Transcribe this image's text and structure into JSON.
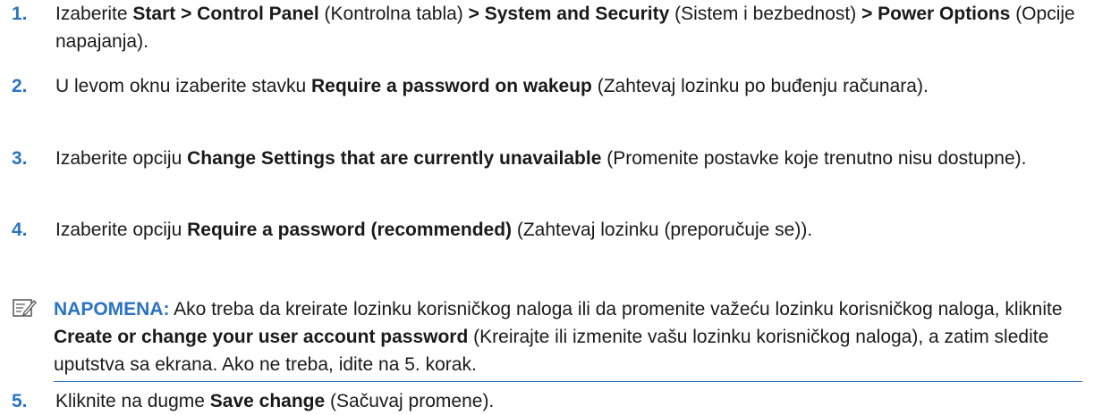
{
  "steps": [
    {
      "number": "1.",
      "text": [
        {
          "t": "Izaberite ",
          "b": false
        },
        {
          "t": "Start > Control Panel",
          "b": true
        },
        {
          "t": " (Kontrolna tabla) ",
          "b": false
        },
        {
          "t": "> System and Security",
          "b": true
        },
        {
          "t": " (Sistem i bezbednost) ",
          "b": false
        },
        {
          "t": "> Power Options",
          "b": true
        },
        {
          "t": " (Opcije napajanja).",
          "b": false
        }
      ]
    },
    {
      "number": "2.",
      "text": [
        {
          "t": "U levom oknu izaberite stavku ",
          "b": false
        },
        {
          "t": "Require a password on wakeup",
          "b": true
        },
        {
          "t": " (Zahtevaj lozinku po buđenju računara).",
          "b": false
        }
      ]
    },
    {
      "number": "3.",
      "text": [
        {
          "t": "Izaberite opciju ",
          "b": false
        },
        {
          "t": "Change Settings that are currently unavailable",
          "b": true
        },
        {
          "t": " (Promenite postavke koje trenutno nisu dostupne).",
          "b": false
        }
      ]
    },
    {
      "number": "4.",
      "text": [
        {
          "t": "Izaberite opciju ",
          "b": false
        },
        {
          "t": "Require a password (recommended)",
          "b": true
        },
        {
          "t": " (Zahtevaj lozinku (preporučuje se)).",
          "b": false
        }
      ]
    }
  ],
  "note": {
    "icon": "note-pencil-icon",
    "label": "NAPOMENA:",
    "text": [
      {
        "t": "   Ako treba da kreirate lozinku korisničkog naloga ili da promenite važeću lozinku korisničkog naloga, kliknite ",
        "b": false
      },
      {
        "t": "Create or change your user account password",
        "b": true
      },
      {
        "t": " (Kreirajte ili izmenite vašu lozinku korisničkog naloga), a zatim sledite uputstva sa ekrana. Ako ne treba, idite na 5. korak.",
        "b": false
      }
    ]
  },
  "step5": {
    "number": "5.",
    "text": [
      {
        "t": "Kliknite na dugme ",
        "b": false
      },
      {
        "t": "Save change",
        "b": true
      },
      {
        "t": " (Sačuvaj promene).",
        "b": false
      }
    ]
  },
  "colors": {
    "accent": "#2a73c4",
    "text": "#1a1a1a"
  }
}
